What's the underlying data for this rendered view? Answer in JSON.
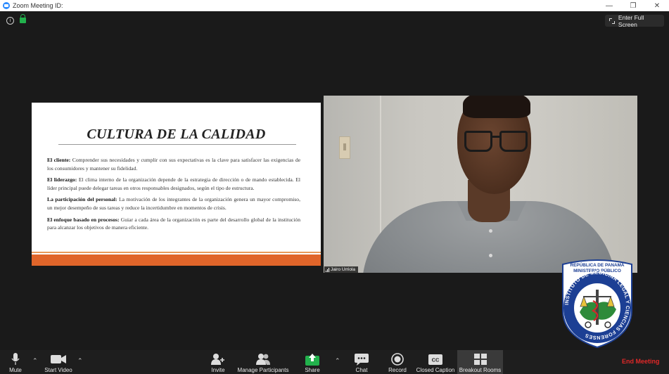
{
  "window": {
    "title": "Zoom Meeting ID:",
    "controls": [
      "—",
      "❐",
      "✕"
    ]
  },
  "header": {
    "fullscreen_label": "Enter Full Screen"
  },
  "slide": {
    "title": "CULTURA DE LA CALIDAD",
    "items": [
      {
        "term": "El cliente:",
        "text": " Comprender sus necesidades y cumplir con sus expectativas es la clave para satisfacer las exigencias de los consumidores y mantener su fidelidad."
      },
      {
        "term": "El liderazgo:",
        "text": " El clima interno de la organización depende de la estrategia de dirección o de mando establecida. El líder principal puede delegar tareas en otros responsables designados, según el tipo de estructura."
      },
      {
        "term": "La participación del personal:",
        "text": " La motivación de los integrantes de la organización genera un mayor compromiso, un mejor desempeño de sus tareas y reduce la incertidumbre en momentos de crisis."
      },
      {
        "term": "El enfoque basado en procesos:",
        "text": " Guiar a cada área de la organización es parte del desarrollo global de la institución para alcanzar los objetivos de manera eficiente."
      }
    ],
    "accent_color": "#e0652a"
  },
  "participant": {
    "name": "Jairo Urriola"
  },
  "logo": {
    "top_line1": "REPÚBLICA DE PANAMÁ",
    "top_line2": "MINISTERIO PÚBLICO",
    "ring_text": "INSTITUTO DE MEDICINA LEGAL Y CIENCIAS FORENSES"
  },
  "toolbar": {
    "mute": "Mute",
    "start_video": "Start Video",
    "invite": "Invite",
    "manage_participants": "Manage Participants",
    "share": "Share",
    "chat": "Chat",
    "record": "Record",
    "closed_caption": "Closed Caption",
    "closed_caption_icon_text": "CC",
    "breakout_rooms": "Breakout Rooms",
    "end_meeting": "End Meeting",
    "share_color": "#22b14c",
    "end_color": "#e02828"
  }
}
